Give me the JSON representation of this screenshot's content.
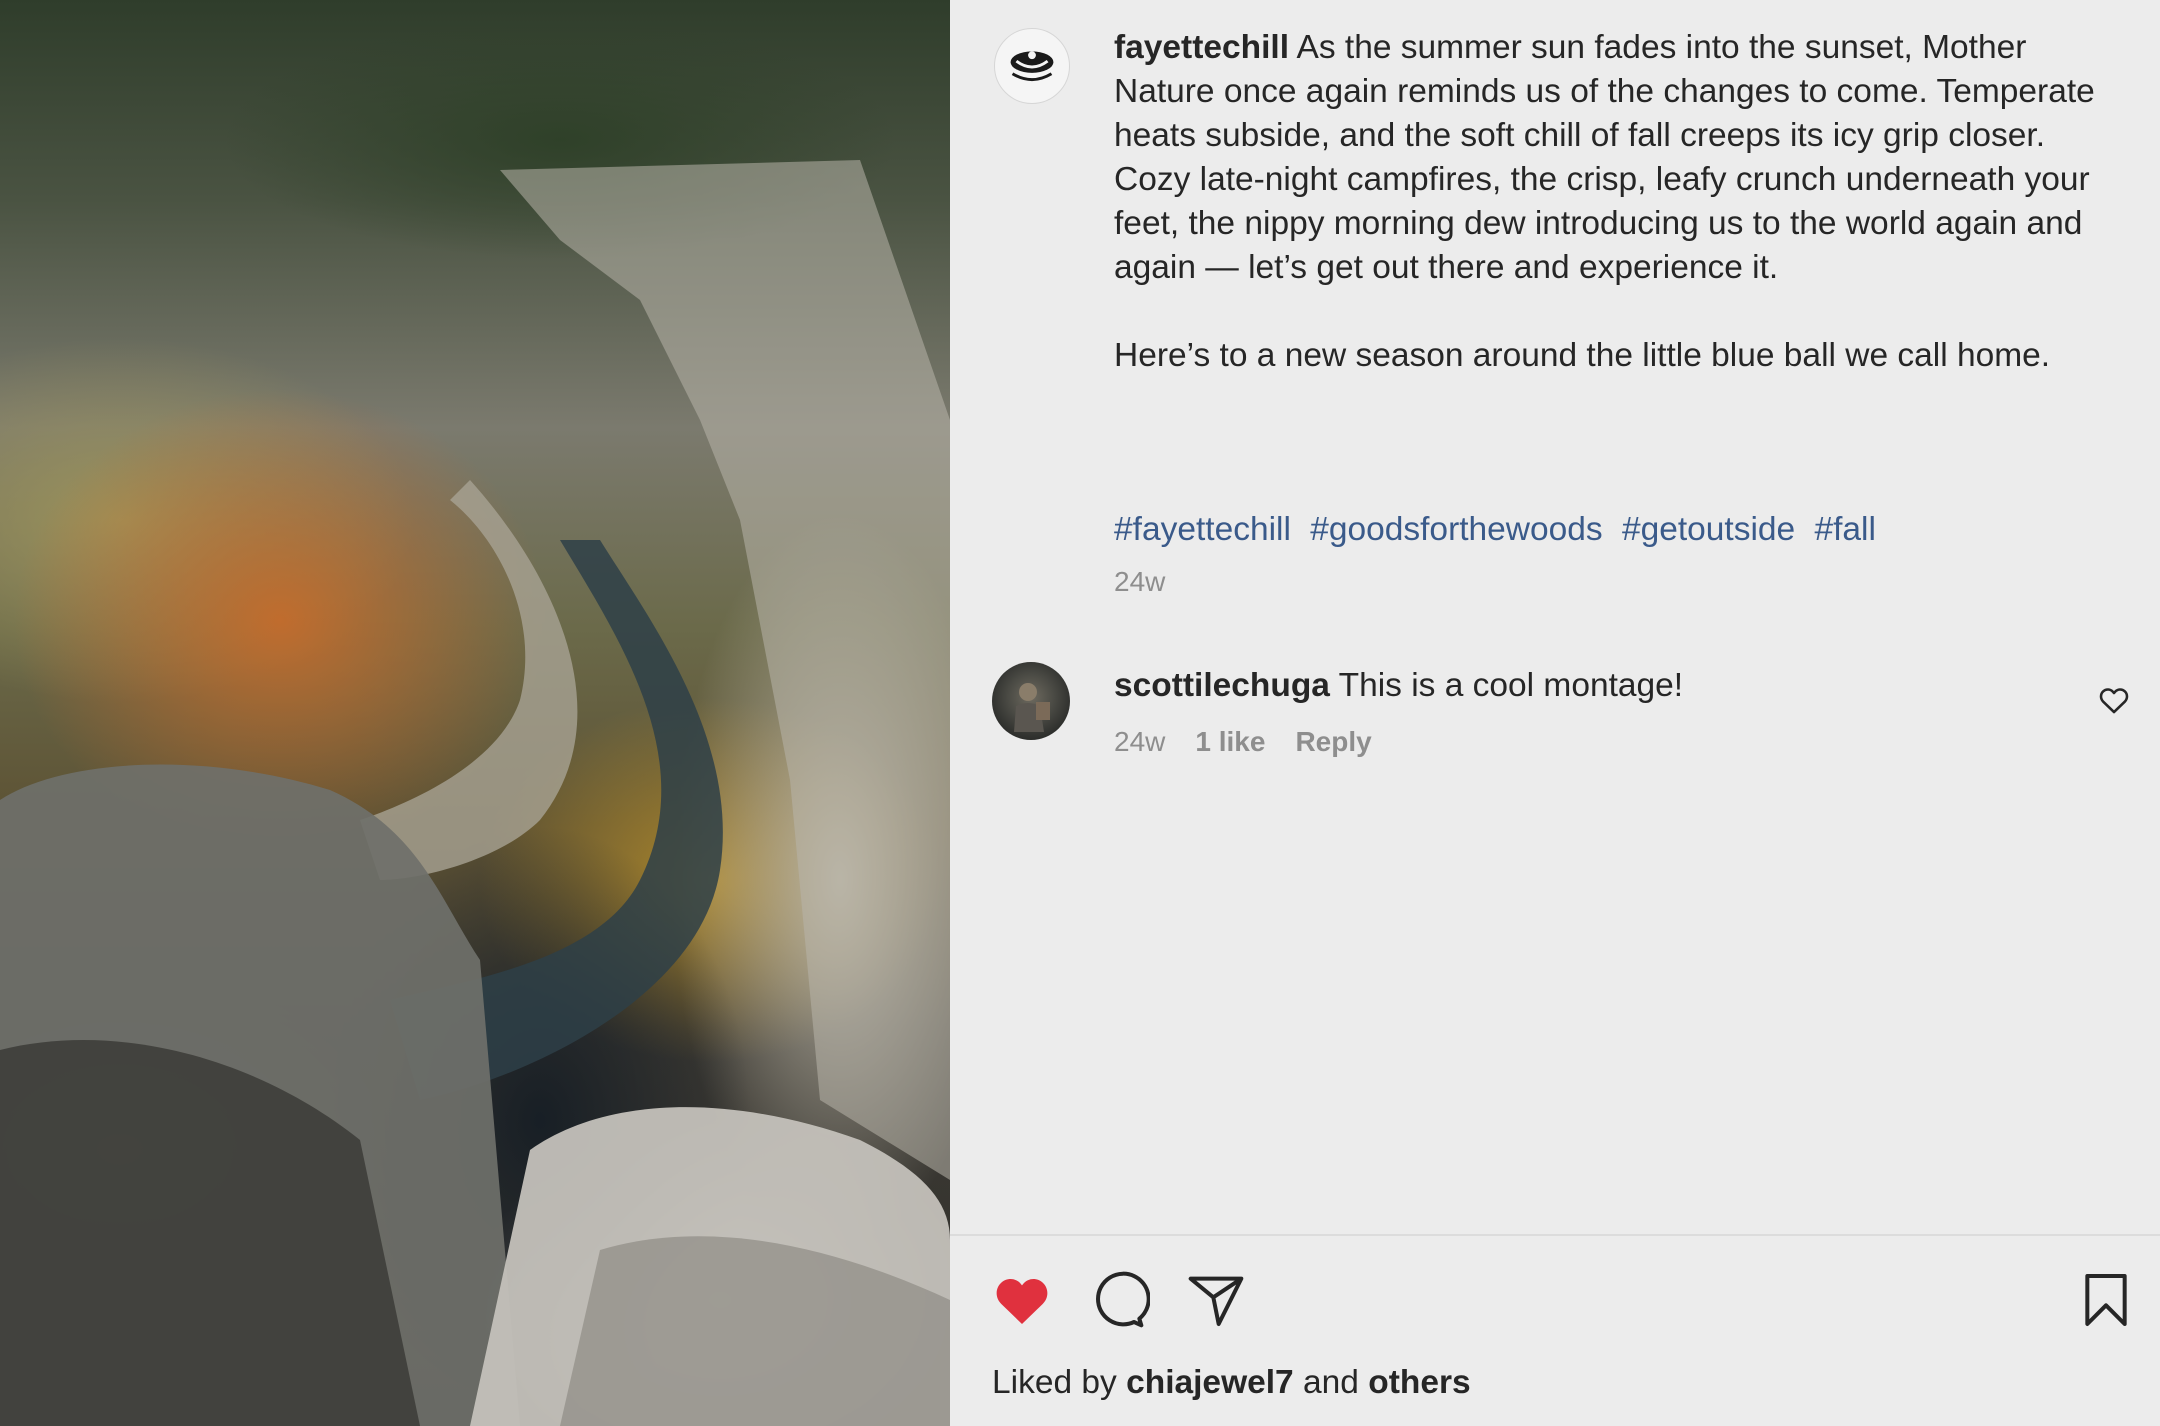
{
  "post": {
    "author": "fayettechill",
    "caption_p1": "As the summer sun fades into the sunset, Mother Nature once again reminds us of the changes to come. Temperate heats subside, and the soft chill of fall creeps its icy grip closer. Cozy late-night campfires, the crisp, leafy crunch underneath your feet, the nippy morning dew introducing us to the world again and again — let’s get out there and experience it.",
    "caption_p2": "Here’s to a new season around the little blue ball we call home.",
    "hashtags": [
      "#fayettechill",
      "#goodsforthewoods",
      "#getoutside",
      "#fall"
    ],
    "time": "24w"
  },
  "comment": {
    "username": "scottilechuga",
    "text": "This is a cool montage!",
    "time": "24w",
    "likes": "1 like",
    "reply_label": "Reply"
  },
  "actions": {
    "like_icon": "heart-filled-icon",
    "comment_icon": "comment-bubble-icon",
    "share_icon": "paper-plane-icon",
    "save_icon": "bookmark-icon",
    "liked_color": "#e0313e"
  },
  "likes": {
    "prefix": "Liked by",
    "user": "chiajewel7",
    "conjunction": "and",
    "others": "others"
  }
}
